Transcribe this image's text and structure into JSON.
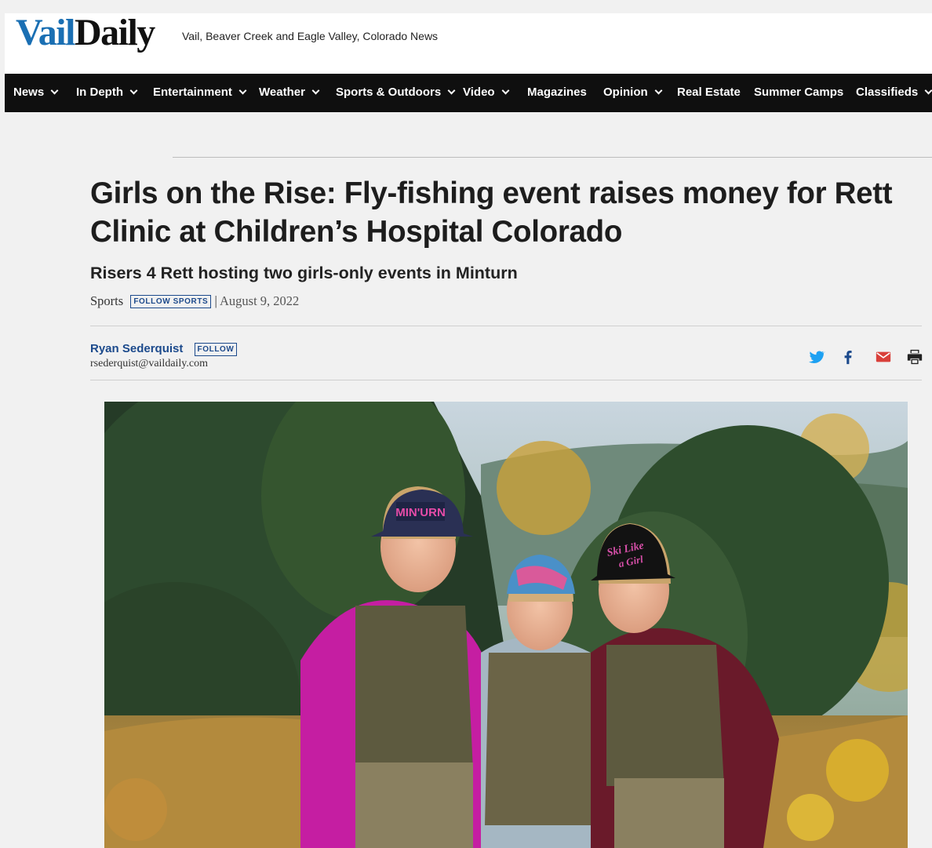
{
  "site": {
    "logo_part1": "Vail",
    "logo_part2": "Daily",
    "tagline": "Vail, Beaver Creek and Eagle Valley, Colorado News",
    "brand_color": "#1a6fb3"
  },
  "nav": {
    "items": [
      {
        "label": "News",
        "dropdown": true
      },
      {
        "label": "In Depth",
        "dropdown": true
      },
      {
        "label": "Entertainment",
        "dropdown": true
      },
      {
        "label": "Weather",
        "dropdown": true
      },
      {
        "label": "Sports & Outdoors",
        "dropdown": true
      },
      {
        "label": "Video",
        "dropdown": true
      },
      {
        "label": "Magazines",
        "dropdown": false
      },
      {
        "label": "Opinion",
        "dropdown": true
      },
      {
        "label": "Real Estate",
        "dropdown": false
      },
      {
        "label": "Summer Camps",
        "dropdown": false
      },
      {
        "label": "Classifieds",
        "dropdown": true
      }
    ]
  },
  "article": {
    "headline": "Girls on the Rise: Fly-fishing event raises money for Rett Clinic at Children’s Hospital Colorado",
    "subhead": "Risers 4 Rett hosting two girls-only events in Minturn",
    "section": "Sports",
    "follow_section_label": "FOLLOW SPORTS",
    "date_sep": "|",
    "date": "August 9, 2022",
    "author_name": "Ryan Sederquist",
    "follow_author_label": "FOLLOW",
    "author_email": "rsederquist@vaildaily.com"
  },
  "share": {
    "icons": [
      "twitter-icon",
      "facebook-icon",
      "email-icon",
      "print-icon"
    ],
    "colors": {
      "twitter": "#1da1f2",
      "facebook": "#1c4a8c",
      "email": "#d9403a",
      "print": "#222222"
    }
  },
  "photo": {
    "subject": "three girls in fly-fishing vests and caps standing in a golden meadow with pine trees",
    "cap_text_1": "MIN'URN",
    "cap_text_2": "Ski Like a Girl"
  }
}
